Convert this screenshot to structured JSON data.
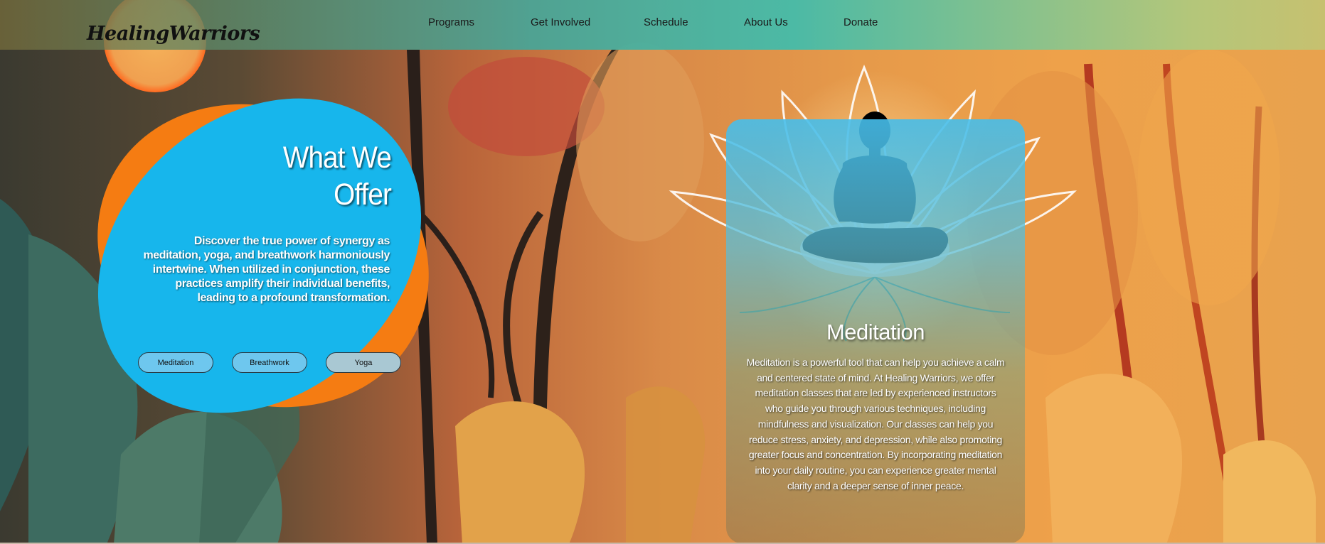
{
  "logo": {
    "text": "HealingWarriors"
  },
  "nav": {
    "items": [
      {
        "label": "Programs"
      },
      {
        "label": "Get Involved"
      },
      {
        "label": "Schedule"
      },
      {
        "label": "About Us"
      },
      {
        "label": "Donate"
      }
    ]
  },
  "offer": {
    "title_line1": "What We",
    "title_line2": "Offer",
    "description": "Discover the true power of synergy as meditation, yoga, and breathwork harmoniously intertwine. When utilized in conjunction, these practices amplify their individual benefits, leading to a profound transformation.",
    "buttons": [
      {
        "label": "Meditation"
      },
      {
        "label": "Breathwork"
      },
      {
        "label": "Yoga"
      }
    ]
  },
  "card": {
    "title": "Meditation",
    "text": "Meditation is a powerful tool that can help you achieve a calm and centered state of mind. At Healing Warriors, we offer meditation classes that are led by experienced instructors who guide you through various techniques, including mindfulness and visualization. Our classes can help you reduce stress, anxiety, and depression, while also promoting greater focus and concentration. By incorporating meditation into your daily routine, you can experience greater mental clarity and a deeper sense of inner peace."
  },
  "colors": {
    "blob_blue": "#17b6ec",
    "blob_orange": "#f57c12",
    "card_top": "#46bee9"
  }
}
